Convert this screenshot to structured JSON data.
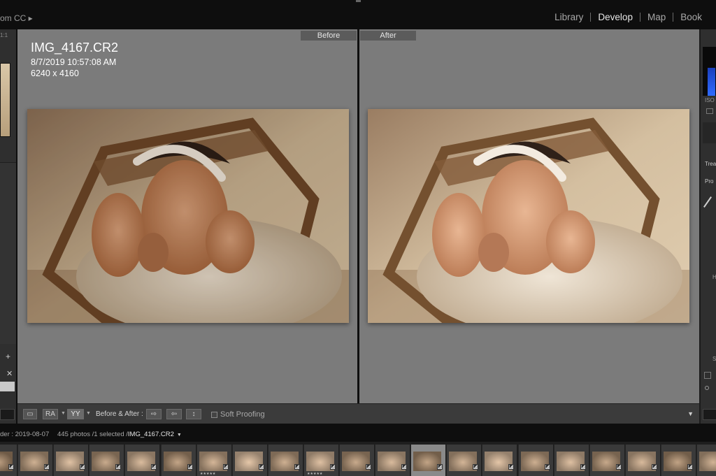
{
  "app": {
    "title": "om CC ▸"
  },
  "modules": [
    {
      "label": "Library",
      "active": false
    },
    {
      "label": "Develop",
      "active": true
    },
    {
      "label": "Map",
      "active": false
    },
    {
      "label": "Book",
      "active": false
    }
  ],
  "left_panel": {
    "zoom": "1:1"
  },
  "center": {
    "before_label": "Before",
    "after_label": "After",
    "info": {
      "filename": "IMG_4167.CR2",
      "datetime": "8/7/2019 10:57:08 AM",
      "dimensions": "6240 x 4160"
    }
  },
  "toolbar": {
    "view_ra": "RA",
    "view_yy": "YY",
    "before_after_label": "Before & After :",
    "swap_right": "⇨",
    "swap_left": "⇦",
    "swap_updown": "↕",
    "soft_proofing": "Soft Proofing",
    "menu_caret": "▼"
  },
  "right_panel": {
    "iso": "ISO",
    "treatment": "Trea",
    "profile": "Pro",
    "h": "H",
    "s": "S"
  },
  "filmstrip": {
    "folder": "der : 2019-08-07",
    "count": "445 photos /1 selected /",
    "current_file": "IMG_4167.CR2",
    "thumbnails": [
      {
        "stars": ""
      },
      {
        "stars": ""
      },
      {
        "stars": ""
      },
      {
        "stars": ""
      },
      {
        "stars": ""
      },
      {
        "stars": ""
      },
      {
        "stars": "★★★★★"
      },
      {
        "stars": ""
      },
      {
        "stars": ""
      },
      {
        "stars": "★★★★★"
      },
      {
        "stars": ""
      },
      {
        "stars": ""
      },
      {
        "stars": "",
        "selected": true
      },
      {
        "stars": ""
      },
      {
        "stars": ""
      },
      {
        "stars": ""
      },
      {
        "stars": ""
      },
      {
        "stars": ""
      },
      {
        "stars": ""
      },
      {
        "stars": ""
      },
      {
        "stars": ""
      }
    ]
  }
}
